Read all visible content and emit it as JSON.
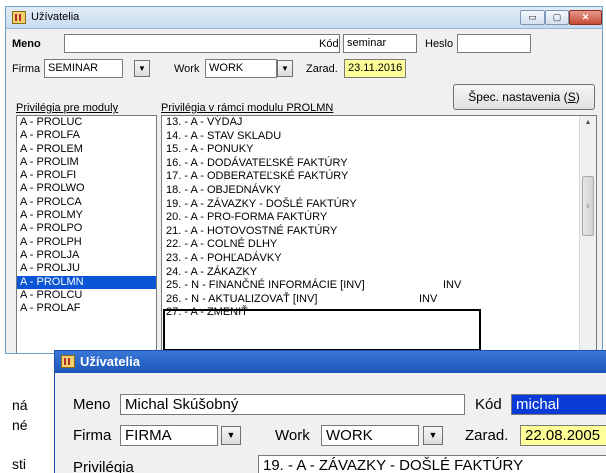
{
  "background_doc": {
    "fragments": [
      "ná",
      "né",
      "sti"
    ]
  },
  "window1": {
    "title": "Užívatelia",
    "controls": {
      "minimize": "▭",
      "maximize": "▢",
      "close": "✕"
    },
    "form": {
      "meno_label": "Meno",
      "meno_value": "",
      "kod_label": "Kód",
      "kod_value": "seminar",
      "heslo_label": "Heslo",
      "heslo_value": "",
      "firma_label": "Firma",
      "firma_value": "SEMINAR",
      "work_label": "Work",
      "work_value": "WORK",
      "zarad_label": "Zarad.",
      "zarad_value": "23.11.2016",
      "spec_button": {
        "label": "Špec. nastavenia (",
        "shortcut": "S",
        "close": ")"
      }
    },
    "modules": {
      "header": "Privilégia pre moduly",
      "items": [
        "A - PROLUC",
        "A - PROLFA",
        "A - PROLEM",
        "A - PROLIM",
        "A - PROLFI",
        "A - PROLWO",
        "A - PROLCA",
        "A - PROLMY",
        "A - PROLPO",
        "A - PROLPH",
        "A - PROLJA",
        "A - PROLJU",
        "A - PROLMN",
        "A - PROLCU",
        "A - PROLAF"
      ],
      "selected": "A - PROLMN"
    },
    "privileges": {
      "header": "Privilégia v rámci modulu  PROLMN",
      "items": [
        "13. - A - VÝDAJ",
        "14. - A - STAV SKLADU",
        "15. - A - PONUKY",
        "16. - A - DODÁVATEĽSKÉ FAKTÚRY",
        "17. - A - ODBERATEĽSKÉ FAKTÚRY",
        "18. - A - OBJEDNÁVKY",
        "19. - A - ZÁVAZKY - DOŠLÉ FAKTÚRY",
        "20. - A - PRO-FORMA FAKTÚRY",
        "21. - A - HOTOVOSTNÉ FAKTÚRY",
        "22. - A - COLNÉ DLHY",
        "23. - A - POHĽADÁVKY",
        "24. - A - ZÁKAZKY",
        "25. - N - FINANČNÉ INFORMÁCIE  [INV]",
        "26. - N - AKTUALIZOVAŤ  [INV]",
        "27. - A - ZMENIŤ"
      ],
      "tags": {
        "row25": "INV",
        "row26": "INV"
      },
      "scroll_arrow": "▲",
      "scroll_grip": "≡"
    }
  },
  "window2": {
    "title": "Užívatelia",
    "form": {
      "meno_label": "Meno",
      "meno_value": "Michal Skúšobný",
      "kod_label": "Kód",
      "kod_value": "michal",
      "firma_label": "Firma",
      "firma_value": "FIRMA",
      "work_label": "Work",
      "work_value": "WORK",
      "zarad_label": "Zarad.",
      "zarad_value": "22.08.2005",
      "privilegia_label": "Privilégia",
      "privilege_row": "19. - A - ZÁVAZKY - DOŠLÉ FAKTÚRY"
    }
  },
  "colors": {
    "selection": "#0a54d6",
    "date_field": "#ffff99",
    "code_field_highlight": "#0a3bd6",
    "title_active": "#1b56b8"
  }
}
